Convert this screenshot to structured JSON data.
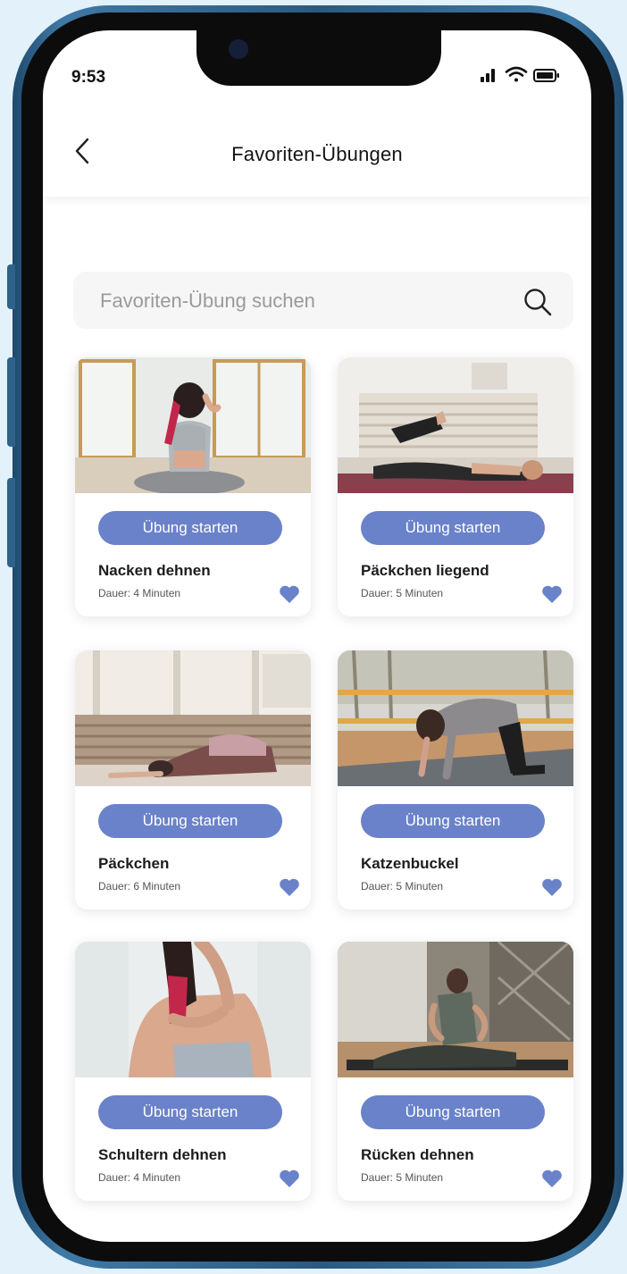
{
  "status_bar": {
    "time": "9:53"
  },
  "header": {
    "title": "Favoriten-Übungen"
  },
  "search": {
    "placeholder": "Favoriten-Übung suchen"
  },
  "exercises": [
    {
      "title": "Nacken dehnen",
      "duration": "Dauer: 4 Minuten",
      "button": "Übung starten"
    },
    {
      "title": "Päckchen liegend",
      "duration": "Dauer: 5 Minuten",
      "button": "Übung starten"
    },
    {
      "title": "Päckchen",
      "duration": "Dauer: 6 Minuten",
      "button": "Übung starten"
    },
    {
      "title": "Katzenbuckel",
      "duration": "Dauer: 5 Minuten",
      "button": "Übung starten"
    },
    {
      "title": "Schultern dehnen",
      "duration": "Dauer: 4 Minuten",
      "button": "Übung starten"
    },
    {
      "title": "Rücken dehnen",
      "duration": "Dauer: 5 Minuten",
      "button": "Übung starten"
    }
  ],
  "colors": {
    "accent": "#6a82c9",
    "frame": "#3f79a5",
    "background": "#e3f1fb"
  }
}
